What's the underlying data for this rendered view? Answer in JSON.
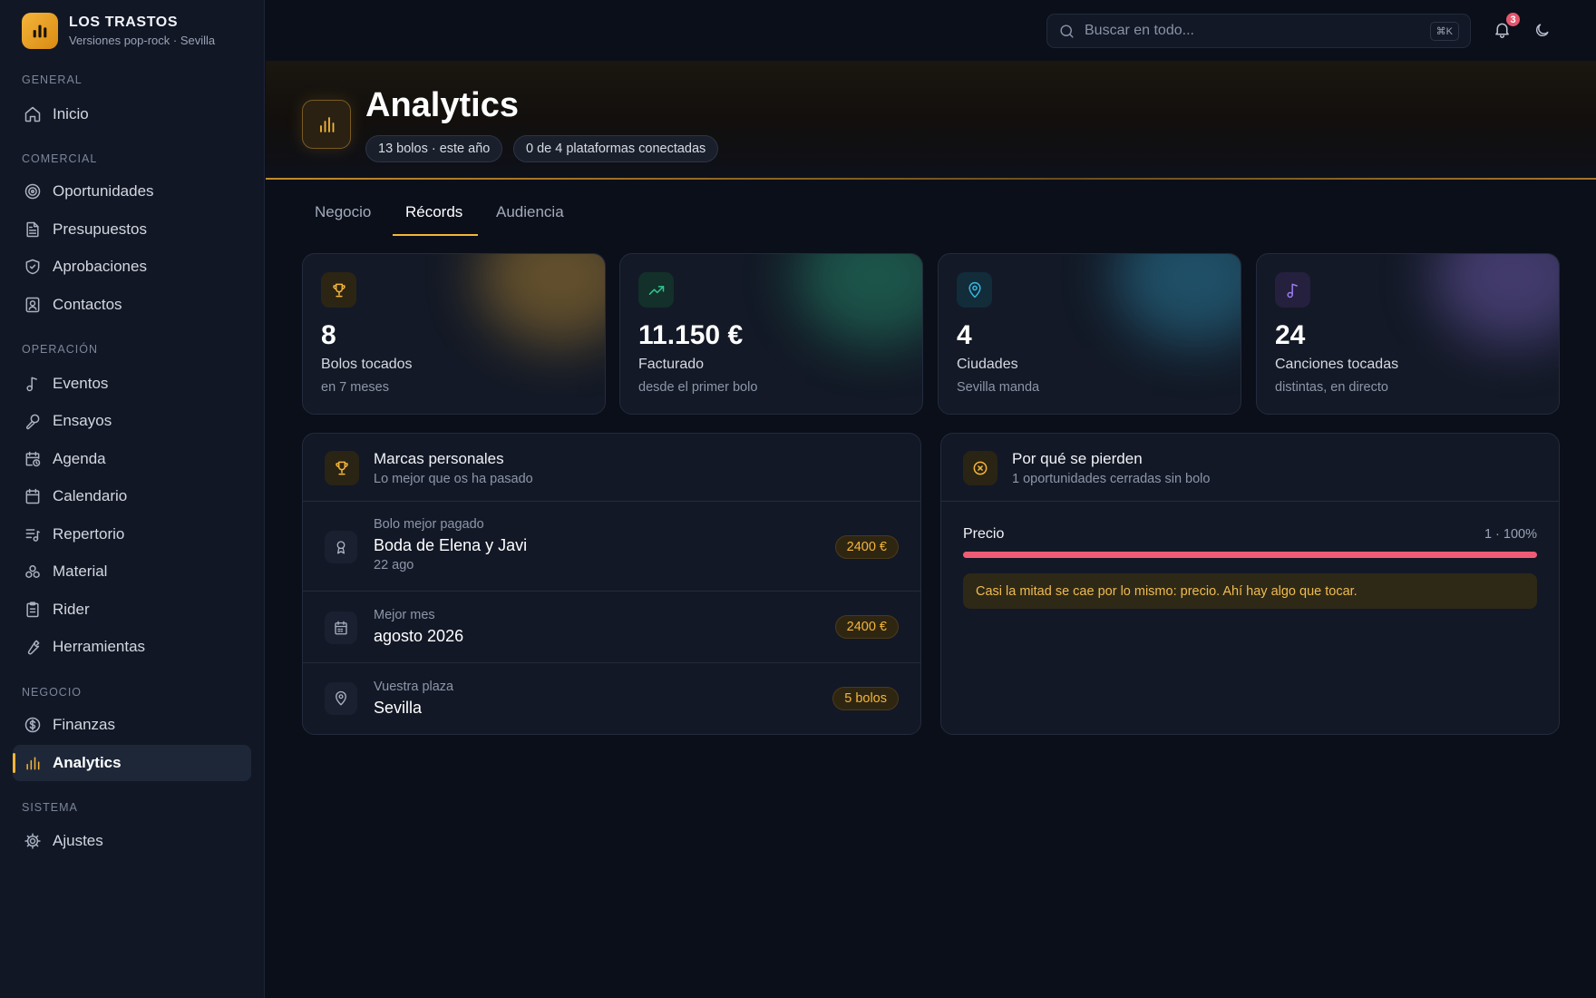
{
  "brand": {
    "name": "LOS TRASTOS",
    "subtitle": "Versiones pop-rock · Sevilla"
  },
  "sidebar": {
    "sections": {
      "general": "GENERAL",
      "comercial": "COMERCIAL",
      "operacion": "OPERACIÓN",
      "negocio": "NEGOCIO",
      "sistema": "SISTEMA"
    },
    "items": {
      "inicio": "Inicio",
      "oportunidades": "Oportunidades",
      "presupuestos": "Presupuestos",
      "aprobaciones": "Aprobaciones",
      "contactos": "Contactos",
      "eventos": "Eventos",
      "ensayos": "Ensayos",
      "agenda": "Agenda",
      "calendario": "Calendario",
      "repertorio": "Repertorio",
      "material": "Material",
      "rider": "Rider",
      "herramientas": "Herramientas",
      "finanzas": "Finanzas",
      "analytics": "Analytics",
      "ajustes": "Ajustes"
    },
    "active": "analytics"
  },
  "topbar": {
    "search_placeholder": "Buscar en todo...",
    "shortcut": "⌘K",
    "notifications_count": "3"
  },
  "header": {
    "title": "Analytics",
    "chips": [
      "13 bolos · este año",
      "0 de 4 plataformas conectadas"
    ]
  },
  "tabs": [
    "Negocio",
    "Récords",
    "Audiencia"
  ],
  "active_tab": "Récords",
  "stats": [
    {
      "icon": "trophy-icon",
      "value": "8",
      "label": "Bolos tocados",
      "sub": "en 7 meses",
      "color": "#f5b53a"
    },
    {
      "icon": "trending-up-icon",
      "value": "11.150 €",
      "label": "Facturado",
      "sub": "desde el primer bolo",
      "color": "#2fc48d"
    },
    {
      "icon": "map-pin-icon",
      "value": "4",
      "label": "Ciudades",
      "sub": "Sevilla manda",
      "color": "#38b6e0"
    },
    {
      "icon": "music-note-icon",
      "value": "24",
      "label": "Canciones tocadas",
      "sub": "distintas, en directo",
      "color": "#9a7cf0"
    }
  ],
  "records": {
    "title": "Marcas personales",
    "subtitle": "Lo mejor que os ha pasado",
    "rows": [
      {
        "icon": "award-icon",
        "label": "Bolo mejor pagado",
        "value": "Boda de Elena y Javi",
        "date": "22 ago",
        "badge": "2400 €"
      },
      {
        "icon": "calendar-icon",
        "label": "Mejor mes",
        "value": "agosto 2026",
        "badge": "2400 €"
      },
      {
        "icon": "map-pin-icon",
        "label": "Vuestra plaza",
        "value": "Sevilla",
        "badge": "5 bolos"
      }
    ]
  },
  "losses": {
    "title": "Por qué se pierden",
    "subtitle": "1 oportunidades cerradas sin bolo",
    "reasons": [
      {
        "label": "Precio",
        "value": "1 · 100%",
        "fraction": 1.0
      }
    ],
    "note": "Casi la mitad se cae por lo mismo: precio. Ahí hay algo que tocar."
  },
  "colors": {
    "accent": "#f5b53a",
    "danger": "#ef5b75",
    "background": "#0b0f1a"
  }
}
